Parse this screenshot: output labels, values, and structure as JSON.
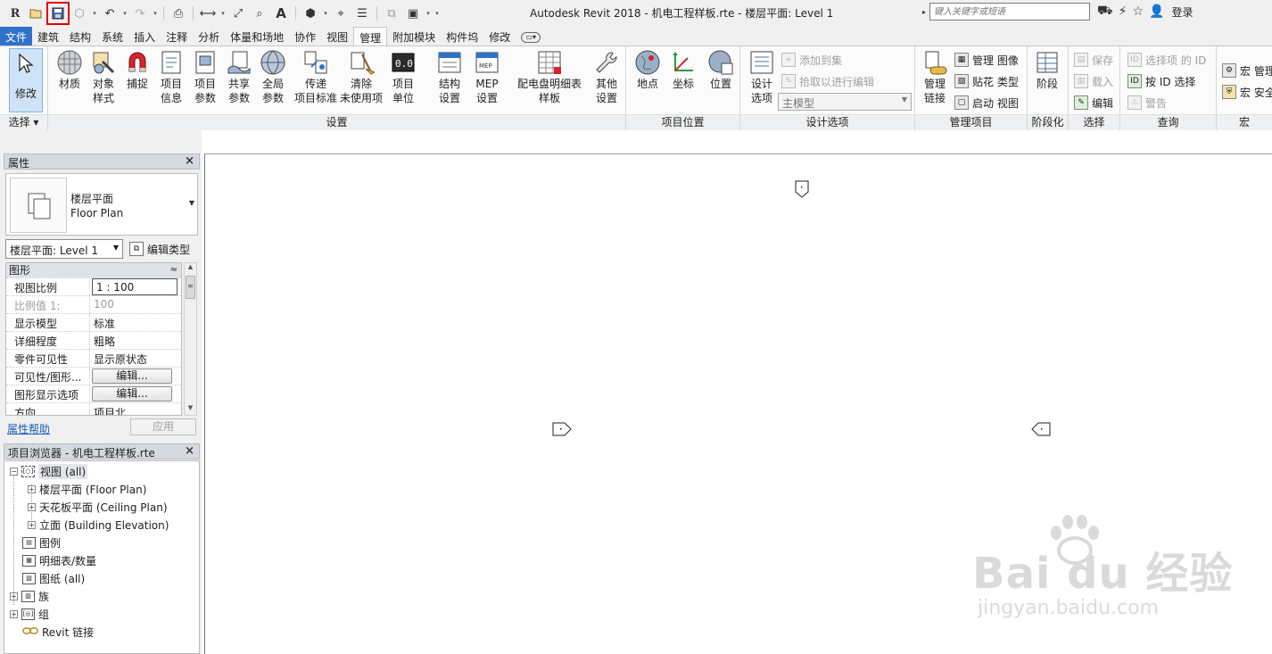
{
  "window": {
    "title": "Autodesk Revit 2018 -    机电工程样板.rte - 楼层平面: Level 1",
    "search_placeholder": "键入关键字或短语",
    "login": "登录"
  },
  "tabs": [
    "文件",
    "建筑",
    "结构",
    "系统",
    "插入",
    "注释",
    "分析",
    "体量和场地",
    "协作",
    "视图",
    "管理",
    "附加模块",
    "构件坞",
    "修改"
  ],
  "ribbon": {
    "modify": {
      "label": "修改",
      "panel": "选择 ▾"
    },
    "settings_buttons": [
      {
        "label": "材质",
        "icon": "material-sphere-icon"
      },
      {
        "label": "对象\n样式",
        "icon": "object-styles-icon"
      },
      {
        "label": "捕捉",
        "icon": "snap-magnet-icon"
      },
      {
        "label": "项目\n信息",
        "icon": "project-info-icon"
      },
      {
        "label": "项目\n参数",
        "icon": "project-parameters-icon"
      },
      {
        "label": "共享\n参数",
        "icon": "shared-parameters-icon"
      },
      {
        "label": "全局\n参数",
        "icon": "global-parameters-icon"
      },
      {
        "label": "传递\n项目标准",
        "icon": "transfer-standards-icon"
      },
      {
        "label": "清除\n未使用项",
        "icon": "purge-unused-icon"
      },
      {
        "label": "项目\n单位",
        "icon": "project-units-icon"
      },
      {
        "label": "结构\n设置",
        "icon": "structural-settings-icon"
      },
      {
        "label": "MEP\n设置",
        "icon": "mep-settings-icon"
      },
      {
        "label": "配电盘明细表\n样板",
        "icon": "panel-schedule-icon"
      },
      {
        "label": "其他\n设置",
        "icon": "wrench-icon"
      }
    ],
    "settings_panel": "设置",
    "location_buttons": [
      {
        "label": "地点",
        "icon": "globe-location-icon"
      },
      {
        "label": "坐标",
        "icon": "coordinates-icon"
      },
      {
        "label": "位置",
        "icon": "position-icon"
      }
    ],
    "location_panel": "项目位置",
    "design_options": {
      "button": "设计\n选项",
      "add_to_set": "添加到集",
      "pick_to_edit": "拾取以进行编辑",
      "main_model": "主模型",
      "panel": "设计选项"
    },
    "manage_project": {
      "links": "管理\n链接",
      "images": "管理 图像",
      "decal_types": "贴花 类型",
      "starting_view": "启动 视图",
      "panel": "管理项目"
    },
    "phasing": {
      "button": "阶段",
      "panel": "阶段化"
    },
    "selection": {
      "save": "保存",
      "load": "载入",
      "edit": "编辑",
      "panel": "选择"
    },
    "inquiry": {
      "ids": "选择项 的 ID",
      "by_id": "按 ID 选择",
      "warnings": "警告",
      "panel": "查询"
    },
    "macros": {
      "manager": "宏 管理",
      "security": "宏 安全",
      "panel": "宏"
    }
  },
  "properties": {
    "title": "属性",
    "type_name_cn": "楼层平面",
    "type_name_en": "Floor Plan",
    "view_selector": "楼层平面: Level 1",
    "edit_type": "编辑类型",
    "category": "图形",
    "rows": [
      {
        "name": "视图比例",
        "value": "1 : 100"
      },
      {
        "name": "比例值 1:",
        "value": "100"
      },
      {
        "name": "显示模型",
        "value": "标准"
      },
      {
        "name": "详细程度",
        "value": "粗略"
      },
      {
        "name": "零件可见性",
        "value": "显示原状态"
      },
      {
        "name": "可见性/图形...",
        "value": "编辑..."
      },
      {
        "name": "图形显示选项",
        "value": "编辑..."
      },
      {
        "name": "方向",
        "value": "项目北"
      }
    ],
    "help": "属性帮助",
    "apply": "应用"
  },
  "browser": {
    "title": "项目浏览器 - 机电工程样板.rte",
    "nodes": [
      {
        "label": "视图 (all)"
      },
      {
        "label": "楼层平面 (Floor Plan)"
      },
      {
        "label": "天花板平面 (Ceiling Plan)"
      },
      {
        "label": "立面 (Building Elevation)"
      },
      {
        "label": "图例"
      },
      {
        "label": "明细表/数量"
      },
      {
        "label": "图纸 (all)"
      },
      {
        "label": "族"
      },
      {
        "label": "组"
      },
      {
        "label": "Revit 链接"
      }
    ]
  },
  "watermark": {
    "main": "Bai du 经验",
    "sub": "jingyan.baidu.com"
  }
}
